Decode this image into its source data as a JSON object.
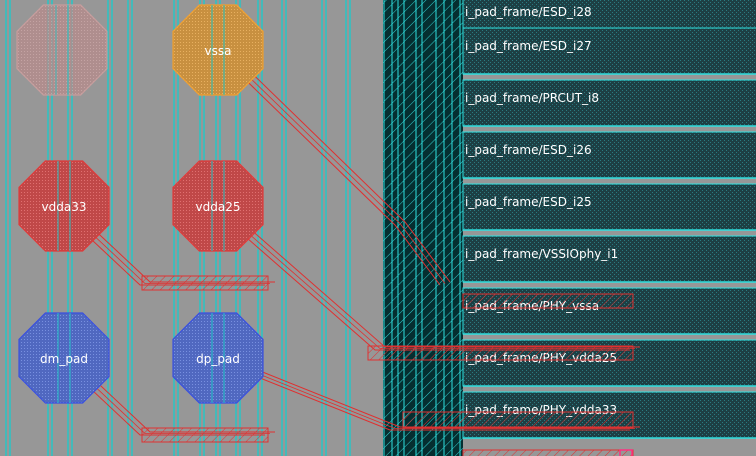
{
  "view": {
    "background": "#979797",
    "track_color": "#22c8c8",
    "core_fill": "#052e30",
    "frame_cell_fill": "#1d3f44",
    "frame_cell_stroke": "#2fe0e0",
    "route_color": "#e03030"
  },
  "pads": [
    {
      "id": "faded",
      "label": "",
      "fill": "#c98a8a",
      "stroke": "#d7a0a0"
    },
    {
      "id": "vssa",
      "label": "vssa",
      "fill": "#d29a4a",
      "stroke": "#f0a030"
    },
    {
      "id": "vdda33",
      "label": "vdda33",
      "fill": "#c85050",
      "stroke": "#e03a3a"
    },
    {
      "id": "vdda25",
      "label": "vdda25",
      "fill": "#c85050",
      "stroke": "#e03a3a"
    },
    {
      "id": "dm_pad",
      "label": "dm_pad",
      "fill": "#6070c8",
      "stroke": "#3a50e0"
    },
    {
      "id": "dp_pad",
      "label": "dp_pad",
      "fill": "#6070c8",
      "stroke": "#3a50e0"
    }
  ],
  "frame_cells": [
    {
      "label": "i_pad_frame/ESD_i28"
    },
    {
      "label": "i_pad_frame/ESD_i27"
    },
    {
      "label": "i_pad_frame/PRCUT_i8"
    },
    {
      "label": "i_pad_frame/ESD_i26"
    },
    {
      "label": "i_pad_frame/ESD_i25"
    },
    {
      "label": "i_pad_frame/VSSIOphy_i1"
    },
    {
      "label": "i_pad_frame/PHY_vssa"
    },
    {
      "label": "i_pad_frame/PHY_vdda25"
    },
    {
      "label": "i_pad_frame/PHY_vdda33"
    }
  ]
}
